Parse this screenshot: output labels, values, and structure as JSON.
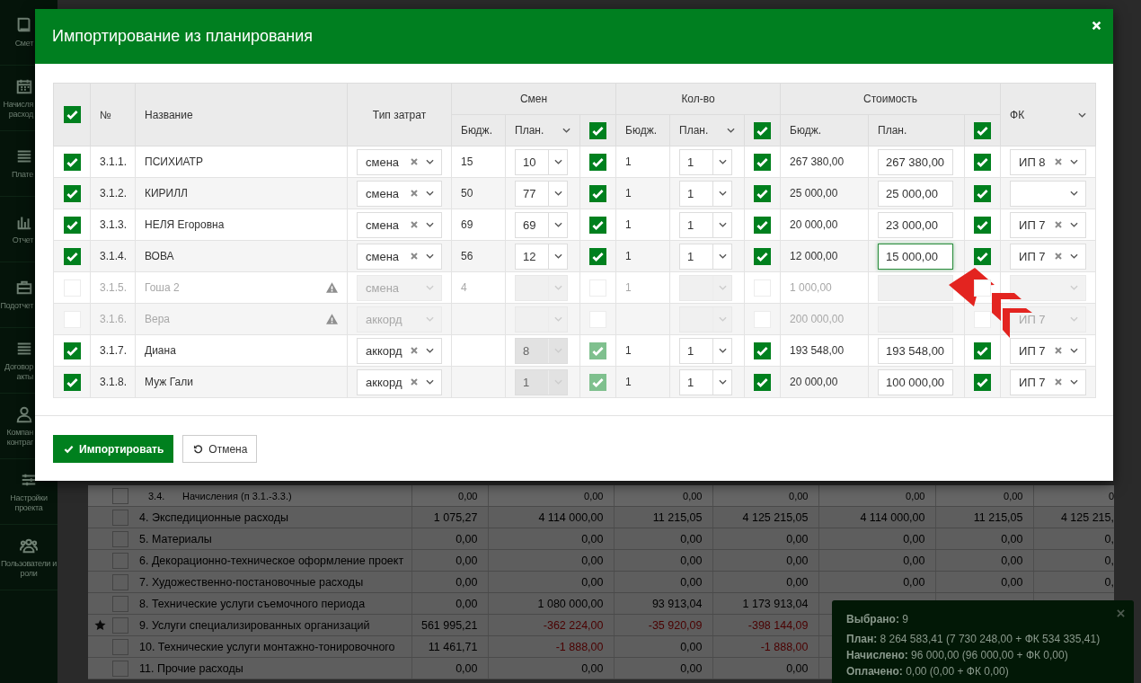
{
  "sidebar": {
    "items": [
      {
        "label": "Смет"
      },
      {
        "label": "Начисля\nрасход"
      },
      {
        "label": "Плате"
      },
      {
        "label": "Отчет"
      },
      {
        "label": "Подотчет"
      },
      {
        "label": "Договор\nакты"
      },
      {
        "label": "Компан\nконтраг"
      },
      {
        "label": "Настройки\nпроекта"
      },
      {
        "label": "Пользователи и\nроли"
      }
    ]
  },
  "background_table": {
    "rows": [
      {
        "kind": "subrow",
        "starred": false,
        "checked": false,
        "number": "3.4.",
        "name": "Начисления (п 3.1.-3.3.)",
        "values": [
          {
            "text": "0,00"
          },
          {
            "text": "0,00"
          },
          {
            "text": "0,00"
          },
          {
            "text": "0,00"
          },
          {
            "text": "0,00"
          },
          {
            "text": "0,00"
          },
          {
            "text": "0"
          }
        ]
      },
      {
        "kind": "section",
        "starred": false,
        "checked": false,
        "name": "4. Экспедиционные расходы",
        "values": [
          {
            "text": "1 075,27"
          },
          {
            "text": "4 114 000,00"
          },
          {
            "text": "11 215,05"
          },
          {
            "text": "4 125 215,05"
          },
          {
            "text": "4 114 000,00"
          },
          {
            "text": "11 215,05"
          },
          {
            "text": "4 125 215,"
          }
        ]
      },
      {
        "kind": "section",
        "starred": false,
        "checked": false,
        "name": "5. Материалы",
        "values": [
          {
            "text": "0,00"
          },
          {
            "text": "0,00"
          },
          {
            "text": "0,00"
          },
          {
            "text": "0,00"
          },
          {
            "text": "0,00"
          },
          {
            "text": "0,00"
          },
          {
            "text": "0,"
          }
        ]
      },
      {
        "kind": "section",
        "starred": false,
        "checked": false,
        "name": "6. Декорационно-техническое оформление проект",
        "values": [
          {
            "text": "0,00"
          },
          {
            "text": "0,00"
          },
          {
            "text": "0,00"
          },
          {
            "text": "0,00"
          },
          {
            "text": "0,00"
          },
          {
            "text": "0,00"
          },
          {
            "text": "0,"
          }
        ]
      },
      {
        "kind": "section",
        "starred": false,
        "checked": false,
        "name": "7. Художественно-постановочные расходы",
        "values": [
          {
            "text": "0,00"
          },
          {
            "text": "0,00"
          },
          {
            "text": "0,00"
          },
          {
            "text": "0,00"
          },
          {
            "text": "0,00"
          },
          {
            "text": "0,00"
          },
          {
            "text": "0,"
          }
        ]
      },
      {
        "kind": "section",
        "starred": false,
        "checked": false,
        "name": "8. Технические услуги съемочного периода",
        "values": [
          {
            "text": "0,00"
          },
          {
            "text": "1 080 000,00"
          },
          {
            "text": "93 913,04"
          },
          {
            "text": "1 173 913,04"
          }
        ]
      },
      {
        "kind": "section",
        "starred": true,
        "checked": false,
        "name": "9. Услуги специализированных организаций",
        "values": [
          {
            "text": "561 995,21",
            "negative": false
          },
          {
            "text": "-362 224,00",
            "negative": true
          },
          {
            "text": "-35 920,09",
            "negative": true
          },
          {
            "text": "-398 144,09",
            "negative": true
          }
        ]
      },
      {
        "kind": "section",
        "starred": false,
        "checked": false,
        "name": "10. Технические услуги монтажно-тонировочного",
        "values": [
          {
            "text": "11 461,71",
            "negative": false
          },
          {
            "text": "-1 888,00",
            "negative": true
          },
          {
            "text": "0,00",
            "negative": false
          },
          {
            "text": "-1 888,00",
            "negative": true
          }
        ]
      },
      {
        "kind": "section",
        "starred": false,
        "checked": false,
        "name": "11. Прочие расходы",
        "values": [
          {
            "text": "0,00"
          },
          {
            "text": "0,00"
          },
          {
            "text": "0,00"
          },
          {
            "text": "0,00"
          }
        ]
      }
    ]
  },
  "modal": {
    "title": "Импортирование из планирования",
    "header": {
      "select_all": true,
      "number": "№",
      "name": "Название",
      "cost_type": "Тип затрат",
      "fk": "ФК",
      "groups": [
        {
          "title": "Смен",
          "budget": "Бюдж.",
          "plan": "План.",
          "plan_menu": true,
          "all_checked": true
        },
        {
          "title": "Кол-во",
          "budget": "Бюдж.",
          "plan": "План.",
          "plan_menu": true,
          "all_checked": true
        },
        {
          "title": "Стоимость",
          "budget": "Бюдж.",
          "plan": "План.",
          "plan_menu": false,
          "all_checked": true
        }
      ]
    },
    "rows": [
      {
        "checked": true,
        "disabled": false,
        "number": "3.1.1.",
        "name": "ПСИХИАТР",
        "warning": false,
        "cost_type": "смена",
        "shifts": {
          "budget": "15",
          "plan": "10",
          "locked": false,
          "checked": true
        },
        "qty": {
          "budget": "1",
          "plan": "1",
          "locked": false,
          "checked": true
        },
        "cost": {
          "budget": "267 380,00",
          "plan": "267 380,00",
          "focused": false,
          "checked": true
        },
        "fk": "ИП 8"
      },
      {
        "checked": true,
        "disabled": false,
        "number": "3.1.2.",
        "name": "КИРИЛЛ",
        "warning": false,
        "cost_type": "смена",
        "shifts": {
          "budget": "50",
          "plan": "77",
          "locked": false,
          "checked": true
        },
        "qty": {
          "budget": "1",
          "plan": "1",
          "locked": false,
          "checked": true
        },
        "cost": {
          "budget": "25 000,00",
          "plan": "25 000,00",
          "focused": false,
          "checked": true
        }
      },
      {
        "checked": true,
        "disabled": false,
        "number": "3.1.3.",
        "name": "НЕЛЯ Егоровна",
        "warning": false,
        "cost_type": "смена",
        "shifts": {
          "budget": "69",
          "plan": "69",
          "locked": false,
          "checked": true
        },
        "qty": {
          "budget": "1",
          "plan": "1",
          "locked": false,
          "checked": true
        },
        "cost": {
          "budget": "20 000,00",
          "plan": "23 000,00",
          "focused": false,
          "checked": true
        },
        "fk": "ИП 7"
      },
      {
        "checked": true,
        "disabled": false,
        "number": "3.1.4.",
        "name": "ВОВА",
        "warning": false,
        "cost_type": "смена",
        "shifts": {
          "budget": "56",
          "plan": "12",
          "locked": false,
          "checked": true
        },
        "qty": {
          "budget": "1",
          "plan": "1",
          "locked": false,
          "checked": true
        },
        "cost": {
          "budget": "12 000,00",
          "plan": "15 000,00",
          "focused": true,
          "checked": true
        },
        "fk": "ИП 7"
      },
      {
        "checked": false,
        "disabled": true,
        "number": "3.1.5.",
        "name": "Гоша 2",
        "warning": true,
        "cost_type": "смена",
        "shifts": {
          "budget": "4",
          "checked": false
        },
        "qty": {
          "budget": "1",
          "checked": false
        },
        "cost": {
          "budget": "1 000,00",
          "focused": false,
          "checked": false
        }
      },
      {
        "checked": false,
        "disabled": true,
        "number": "3.1.6.",
        "name": "Вера",
        "warning": true,
        "cost_type": "аккорд",
        "shifts": {
          "checked": false
        },
        "qty": {
          "checked": false
        },
        "cost": {
          "budget": "200 000,00",
          "focused": false,
          "checked": false
        },
        "fk": "ИП 7"
      },
      {
        "checked": true,
        "disabled": false,
        "number": "3.1.7.",
        "name": "Диана",
        "warning": false,
        "cost_type": "аккорд",
        "shifts": {
          "plan": "8",
          "locked": true,
          "checked": true
        },
        "qty": {
          "budget": "1",
          "plan": "1",
          "locked": false,
          "checked": true
        },
        "cost": {
          "budget": "193 548,00",
          "plan": "193 548,00",
          "focused": false,
          "checked": true
        },
        "fk": "ИП 7"
      },
      {
        "checked": true,
        "disabled": false,
        "number": "3.1.8.",
        "name": "Муж Гали",
        "warning": false,
        "cost_type": "аккорд",
        "shifts": {
          "plan": "1",
          "locked": true,
          "checked": true
        },
        "qty": {
          "budget": "1",
          "plan": "1",
          "locked": false,
          "checked": true
        },
        "cost": {
          "budget": "20 000,00",
          "plan": "100 000,00",
          "focused": false,
          "checked": true
        },
        "fk": "ИП 7"
      }
    ],
    "buttons": [
      {
        "label": "Импортировать",
        "kind": "primary"
      },
      {
        "label": "Отмена",
        "kind": "secondary"
      }
    ]
  },
  "summary_panel": {
    "lines": [
      "**Выбрано:** 9",
      "**План:** 8 264 583,41 (7 730 248,00 + ФК 534 335,41)",
      "**Начислено:** 96 000,00 (96 000,00 + ФК 0,00)",
      "**Оплачено:** 0,00 (0,00 + ФК 0,00)"
    ]
  }
}
